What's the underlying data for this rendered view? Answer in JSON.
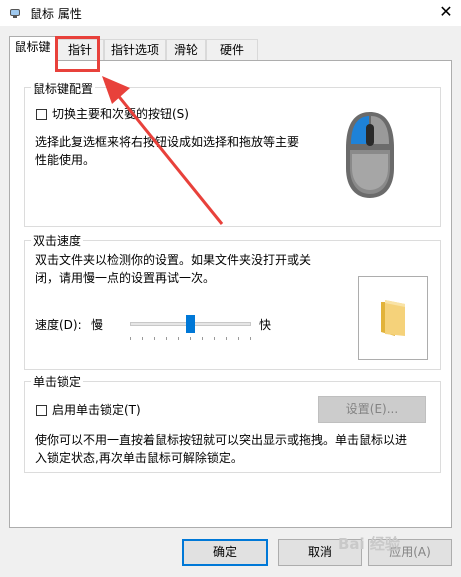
{
  "window": {
    "title": "鼠标 属性",
    "close_glyph": "✕"
  },
  "tabs": [
    {
      "label": "鼠标键",
      "active": true
    },
    {
      "label": "指针",
      "active": false
    },
    {
      "label": "指针选项",
      "active": false
    },
    {
      "label": "滑轮",
      "active": false
    },
    {
      "label": "硬件",
      "active": false
    }
  ],
  "button_config": {
    "legend": "鼠标键配置",
    "checkbox_label": "切换主要和次要的按钮(S)",
    "checked": false,
    "description_line1": "选择此复选框来将右按钮设成如选择和拖放等主要",
    "description_line2": "性能使用。"
  },
  "double_click": {
    "legend": "双击速度",
    "description_line1": "双击文件夹以检测你的设置。如果文件夹没打开或关",
    "description_line2": "闭，请用慢一点的设置再试一次。",
    "speed_label": "速度(D):",
    "slow_label": "慢",
    "fast_label": "快",
    "speed_value_fraction": 0.5
  },
  "click_lock": {
    "legend": "单击锁定",
    "checkbox_label": "启用单击锁定(T)",
    "checked": false,
    "settings_button": "设置(E)...",
    "description_line1": "使你可以不用一直按着鼠标按钮就可以突出显示或拖拽。单击鼠标以进",
    "description_line2": "入锁定状态,再次单击鼠标可解除锁定。"
  },
  "footer": {
    "ok": "确定",
    "cancel": "取消",
    "apply": "应用(A)"
  },
  "watermark": "Bai 经验",
  "colors": {
    "accent": "#0078d7",
    "annotation_red": "#e8413b"
  }
}
